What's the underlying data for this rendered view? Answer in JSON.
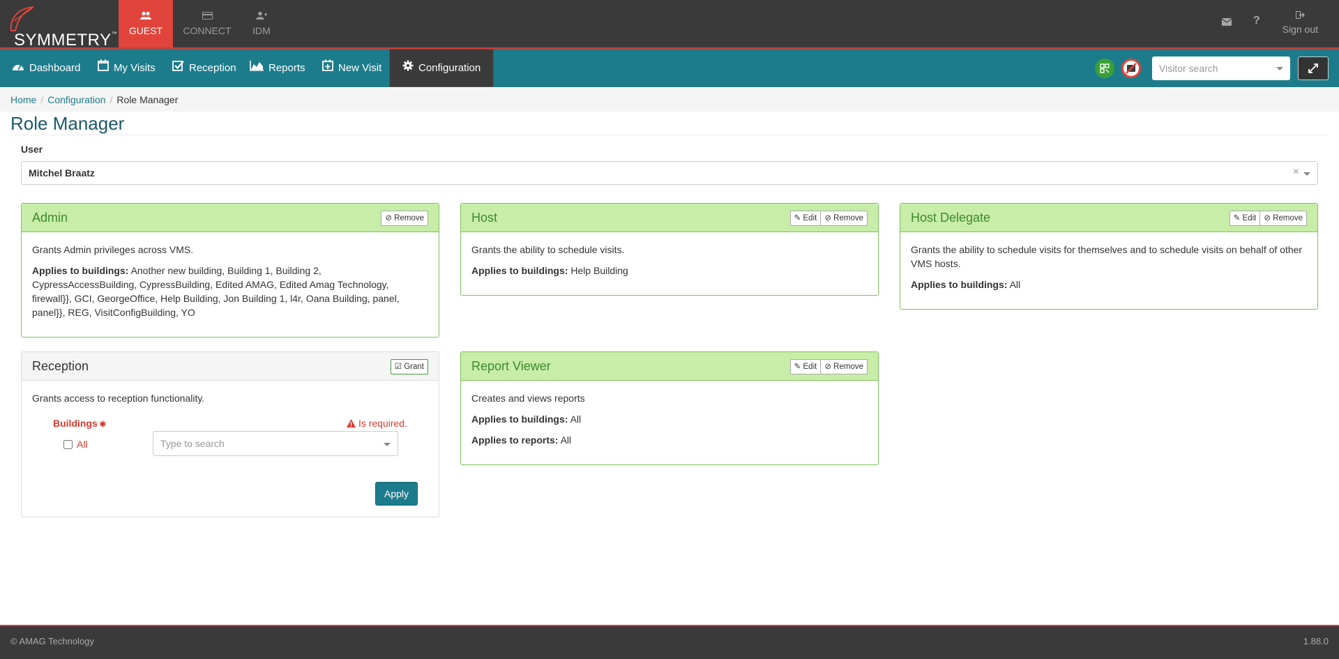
{
  "topbar": {
    "logo_text": "SYMMETRY",
    "logo_tm": "™",
    "tabs": [
      {
        "label": "GUEST",
        "icon": "users-icon",
        "active": true
      },
      {
        "label": "CONNECT",
        "icon": "card-icon",
        "active": false
      },
      {
        "label": "IDM",
        "icon": "user-plus-icon",
        "active": false
      }
    ],
    "signout_label": "Sign out"
  },
  "nav": {
    "items": [
      {
        "label": "Dashboard",
        "icon": "dashboard-icon"
      },
      {
        "label": "My Visits",
        "icon": "calendar-icon"
      },
      {
        "label": "Reception",
        "icon": "check-square-icon"
      },
      {
        "label": "Reports",
        "icon": "area-chart-icon"
      },
      {
        "label": "New Visit",
        "icon": "calendar-plus-icon"
      },
      {
        "label": "Configuration",
        "icon": "gear-icon",
        "active": true
      }
    ],
    "visitor_search_placeholder": "Visitor search"
  },
  "breadcrumb": {
    "home": "Home",
    "configuration": "Configuration",
    "current": "Role Manager"
  },
  "page": {
    "title": "Role Manager",
    "user_label": "User",
    "user_value": "Mitchel Braatz",
    "clear_symbol": "×"
  },
  "roles": {
    "admin": {
      "title": "Admin",
      "remove_label": "Remove",
      "description": "Grants Admin privileges across VMS.",
      "applies_label": "Applies to buildings:",
      "buildings": "Another new building, Building 1, Building 2, CypressAccessBuilding, CypressBuilding, Edited AMAG, Edited Amag Technology, firewall}}, GCI, GeorgeOffice, Help Building, Jon Building 1, l4r, Oana Building, panel, panel}}, REG, VisitConfigBuilding, YO"
    },
    "host": {
      "title": "Host",
      "edit_label": "Edit",
      "remove_label": "Remove",
      "description": "Grants the ability to schedule visits.",
      "applies_label": "Applies to buildings:",
      "buildings": "Help Building"
    },
    "host_delegate": {
      "title": "Host Delegate",
      "edit_label": "Edit",
      "remove_label": "Remove",
      "description": "Grants the ability to schedule visits for themselves and to schedule visits on behalf of other VMS hosts.",
      "applies_label": "Applies to buildings:",
      "buildings": "All"
    },
    "reception": {
      "title": "Reception",
      "grant_label": "Grant",
      "description": "Grants access to reception functionality.",
      "buildings_label": "Buildings",
      "required_star": "✱",
      "required_msg": "Is required.",
      "all_label": "All",
      "search_placeholder": "Type to search",
      "apply_label": "Apply"
    },
    "report_viewer": {
      "title": "Report Viewer",
      "edit_label": "Edit",
      "remove_label": "Remove",
      "description": "Creates and views reports",
      "applies_buildings_label": "Applies to buildings:",
      "buildings": "All",
      "applies_reports_label": "Applies to reports:",
      "reports": "All"
    }
  },
  "footer": {
    "copyright": "© AMAG Technology",
    "version": "1.88.0"
  },
  "colors": {
    "teal": "#1d7c8c",
    "red_accent": "#e0443b",
    "green_header": "#c8eda8",
    "dark_bar": "#3a3a3a"
  }
}
